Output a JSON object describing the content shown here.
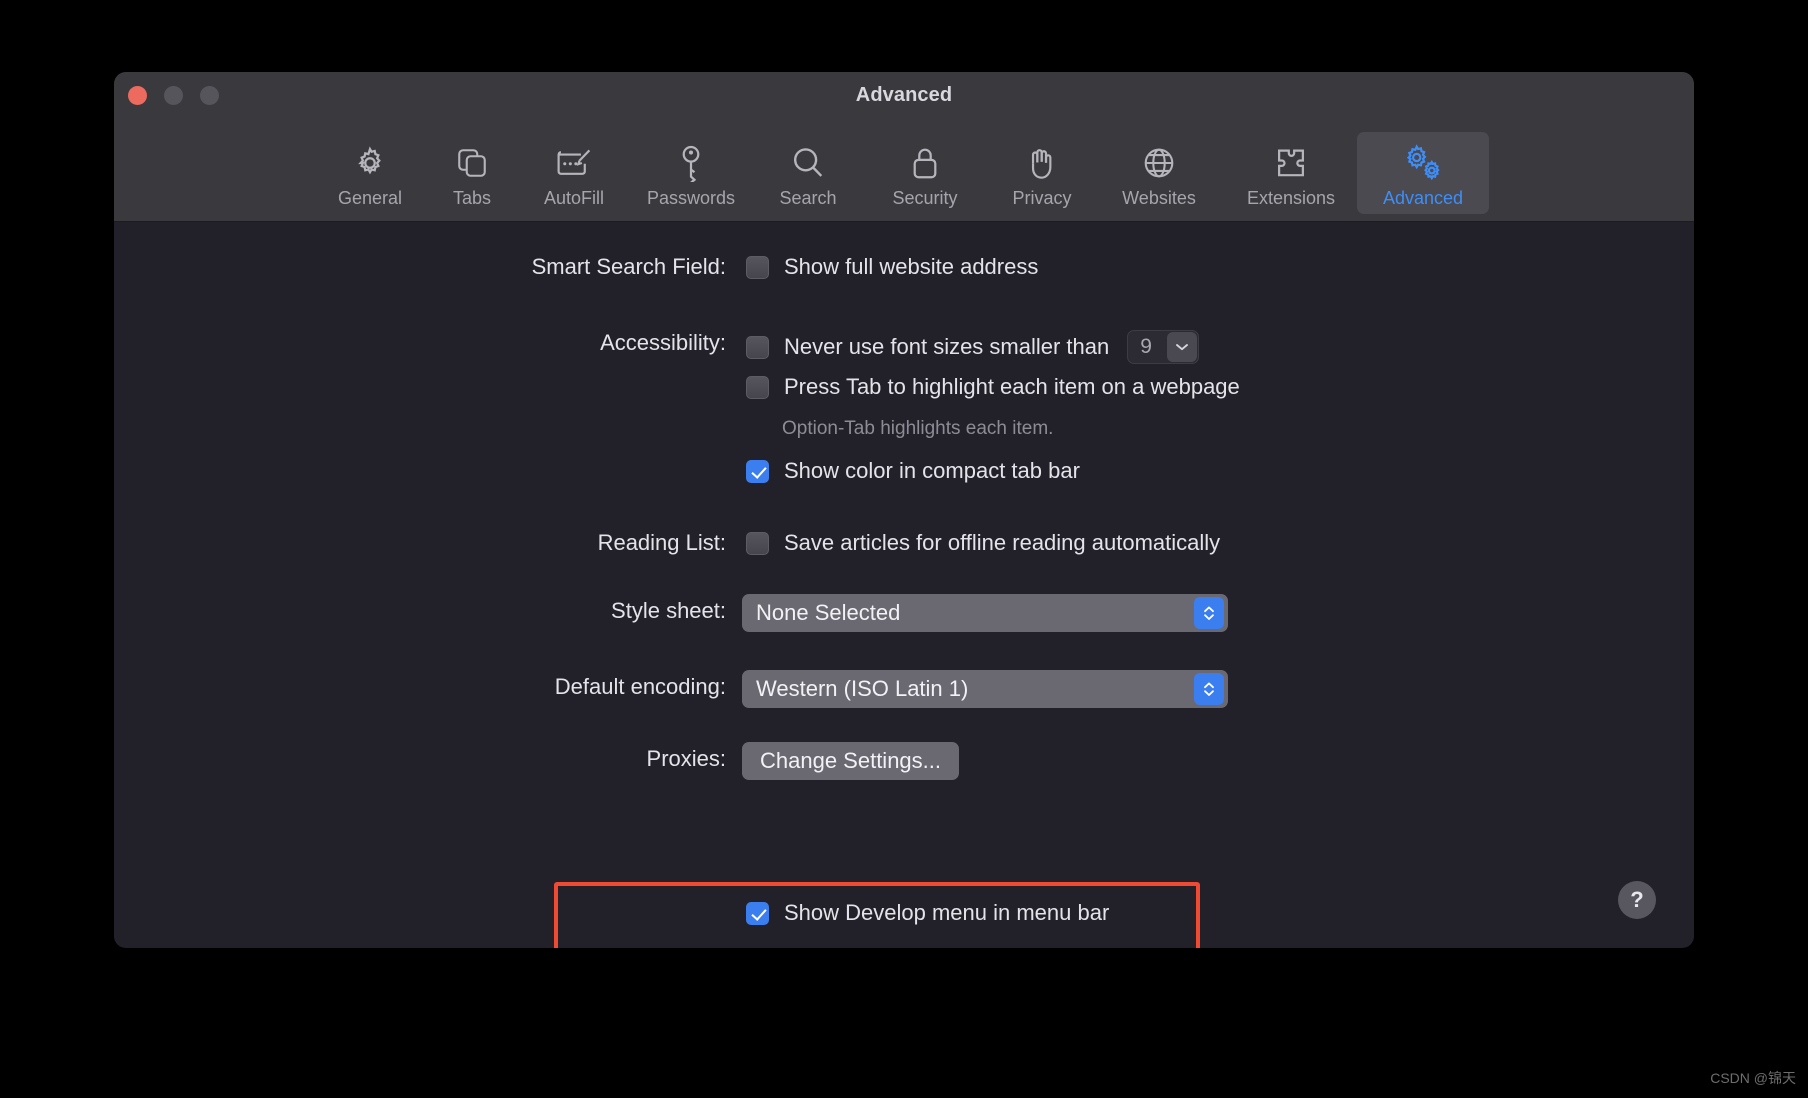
{
  "window": {
    "title": "Advanced",
    "traffic_lights": [
      "close",
      "minimize",
      "zoom"
    ]
  },
  "toolbar": {
    "tabs": [
      {
        "label": "General",
        "icon": "gear-icon",
        "selected": false
      },
      {
        "label": "Tabs",
        "icon": "tabs-icon",
        "selected": false
      },
      {
        "label": "AutoFill",
        "icon": "autofill-icon",
        "selected": false
      },
      {
        "label": "Passwords",
        "icon": "key-icon",
        "selected": false
      },
      {
        "label": "Search",
        "icon": "search-icon",
        "selected": false
      },
      {
        "label": "Security",
        "icon": "lock-icon",
        "selected": false
      },
      {
        "label": "Privacy",
        "icon": "hand-icon",
        "selected": false
      },
      {
        "label": "Websites",
        "icon": "globe-icon",
        "selected": false
      },
      {
        "label": "Extensions",
        "icon": "puzzle-icon",
        "selected": false
      },
      {
        "label": "Advanced",
        "icon": "gears-icon",
        "selected": true
      }
    ]
  },
  "settings": {
    "smart_search": {
      "label": "Smart Search Field:",
      "checkbox_label": "Show full website address",
      "checked": false
    },
    "accessibility": {
      "label": "Accessibility:",
      "font_size_label": "Never use font sizes smaller than",
      "font_size_checked": false,
      "font_size_value": "9",
      "tab_highlight_label": "Press Tab to highlight each item on a webpage",
      "tab_highlight_checked": false,
      "hint": "Option-Tab highlights each item.",
      "compact_tab_label": "Show color in compact tab bar",
      "compact_tab_checked": true
    },
    "reading_list": {
      "label": "Reading List:",
      "checkbox_label": "Save articles for offline reading automatically",
      "checked": false
    },
    "style_sheet": {
      "label": "Style sheet:",
      "value": "None Selected"
    },
    "default_encoding": {
      "label": "Default encoding:",
      "value": "Western (ISO Latin 1)"
    },
    "proxies": {
      "label": "Proxies:",
      "button_label": "Change Settings..."
    },
    "develop_menu": {
      "checkbox_label": "Show Develop menu in menu bar",
      "checked": true,
      "highlight_color": "#f04a32"
    }
  },
  "help_button": {
    "glyph": "?"
  },
  "watermark": {
    "text": "CSDN @锦天"
  },
  "colors": {
    "accent": "#3b7ef0",
    "toolbar_bg": "#3a3a3e",
    "content_bg": "#222029",
    "close_red": "#ec6a5e"
  }
}
